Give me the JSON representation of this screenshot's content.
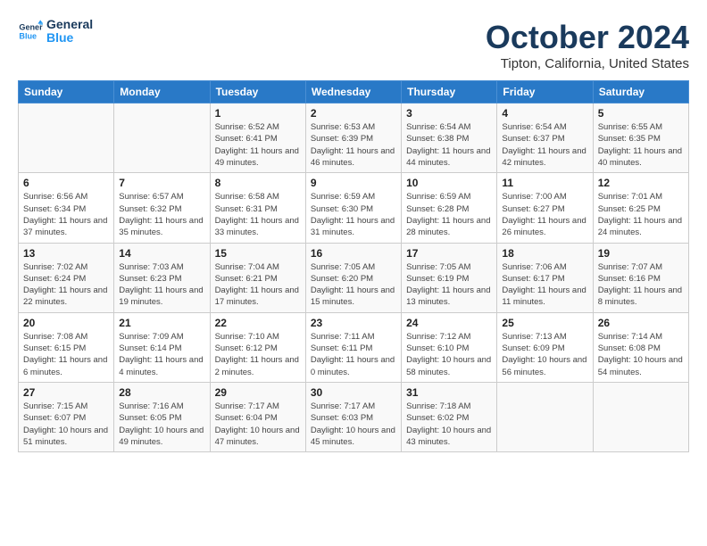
{
  "header": {
    "logo_line1": "General",
    "logo_line2": "Blue",
    "month_title": "October 2024",
    "location": "Tipton, California, United States"
  },
  "weekdays": [
    "Sunday",
    "Monday",
    "Tuesday",
    "Wednesday",
    "Thursday",
    "Friday",
    "Saturday"
  ],
  "weeks": [
    [
      null,
      null,
      {
        "day": 1,
        "sunrise": "6:52 AM",
        "sunset": "6:41 PM",
        "daylight": "11 hours and 49 minutes."
      },
      {
        "day": 2,
        "sunrise": "6:53 AM",
        "sunset": "6:39 PM",
        "daylight": "11 hours and 46 minutes."
      },
      {
        "day": 3,
        "sunrise": "6:54 AM",
        "sunset": "6:38 PM",
        "daylight": "11 hours and 44 minutes."
      },
      {
        "day": 4,
        "sunrise": "6:54 AM",
        "sunset": "6:37 PM",
        "daylight": "11 hours and 42 minutes."
      },
      {
        "day": 5,
        "sunrise": "6:55 AM",
        "sunset": "6:35 PM",
        "daylight": "11 hours and 40 minutes."
      }
    ],
    [
      {
        "day": 6,
        "sunrise": "6:56 AM",
        "sunset": "6:34 PM",
        "daylight": "11 hours and 37 minutes."
      },
      {
        "day": 7,
        "sunrise": "6:57 AM",
        "sunset": "6:32 PM",
        "daylight": "11 hours and 35 minutes."
      },
      {
        "day": 8,
        "sunrise": "6:58 AM",
        "sunset": "6:31 PM",
        "daylight": "11 hours and 33 minutes."
      },
      {
        "day": 9,
        "sunrise": "6:59 AM",
        "sunset": "6:30 PM",
        "daylight": "11 hours and 31 minutes."
      },
      {
        "day": 10,
        "sunrise": "6:59 AM",
        "sunset": "6:28 PM",
        "daylight": "11 hours and 28 minutes."
      },
      {
        "day": 11,
        "sunrise": "7:00 AM",
        "sunset": "6:27 PM",
        "daylight": "11 hours and 26 minutes."
      },
      {
        "day": 12,
        "sunrise": "7:01 AM",
        "sunset": "6:25 PM",
        "daylight": "11 hours and 24 minutes."
      }
    ],
    [
      {
        "day": 13,
        "sunrise": "7:02 AM",
        "sunset": "6:24 PM",
        "daylight": "11 hours and 22 minutes."
      },
      {
        "day": 14,
        "sunrise": "7:03 AM",
        "sunset": "6:23 PM",
        "daylight": "11 hours and 19 minutes."
      },
      {
        "day": 15,
        "sunrise": "7:04 AM",
        "sunset": "6:21 PM",
        "daylight": "11 hours and 17 minutes."
      },
      {
        "day": 16,
        "sunrise": "7:05 AM",
        "sunset": "6:20 PM",
        "daylight": "11 hours and 15 minutes."
      },
      {
        "day": 17,
        "sunrise": "7:05 AM",
        "sunset": "6:19 PM",
        "daylight": "11 hours and 13 minutes."
      },
      {
        "day": 18,
        "sunrise": "7:06 AM",
        "sunset": "6:17 PM",
        "daylight": "11 hours and 11 minutes."
      },
      {
        "day": 19,
        "sunrise": "7:07 AM",
        "sunset": "6:16 PM",
        "daylight": "11 hours and 8 minutes."
      }
    ],
    [
      {
        "day": 20,
        "sunrise": "7:08 AM",
        "sunset": "6:15 PM",
        "daylight": "11 hours and 6 minutes."
      },
      {
        "day": 21,
        "sunrise": "7:09 AM",
        "sunset": "6:14 PM",
        "daylight": "11 hours and 4 minutes."
      },
      {
        "day": 22,
        "sunrise": "7:10 AM",
        "sunset": "6:12 PM",
        "daylight": "11 hours and 2 minutes."
      },
      {
        "day": 23,
        "sunrise": "7:11 AM",
        "sunset": "6:11 PM",
        "daylight": "11 hours and 0 minutes."
      },
      {
        "day": 24,
        "sunrise": "7:12 AM",
        "sunset": "6:10 PM",
        "daylight": "10 hours and 58 minutes."
      },
      {
        "day": 25,
        "sunrise": "7:13 AM",
        "sunset": "6:09 PM",
        "daylight": "10 hours and 56 minutes."
      },
      {
        "day": 26,
        "sunrise": "7:14 AM",
        "sunset": "6:08 PM",
        "daylight": "10 hours and 54 minutes."
      }
    ],
    [
      {
        "day": 27,
        "sunrise": "7:15 AM",
        "sunset": "6:07 PM",
        "daylight": "10 hours and 51 minutes."
      },
      {
        "day": 28,
        "sunrise": "7:16 AM",
        "sunset": "6:05 PM",
        "daylight": "10 hours and 49 minutes."
      },
      {
        "day": 29,
        "sunrise": "7:17 AM",
        "sunset": "6:04 PM",
        "daylight": "10 hours and 47 minutes."
      },
      {
        "day": 30,
        "sunrise": "7:17 AM",
        "sunset": "6:03 PM",
        "daylight": "10 hours and 45 minutes."
      },
      {
        "day": 31,
        "sunrise": "7:18 AM",
        "sunset": "6:02 PM",
        "daylight": "10 hours and 43 minutes."
      },
      null,
      null
    ]
  ]
}
